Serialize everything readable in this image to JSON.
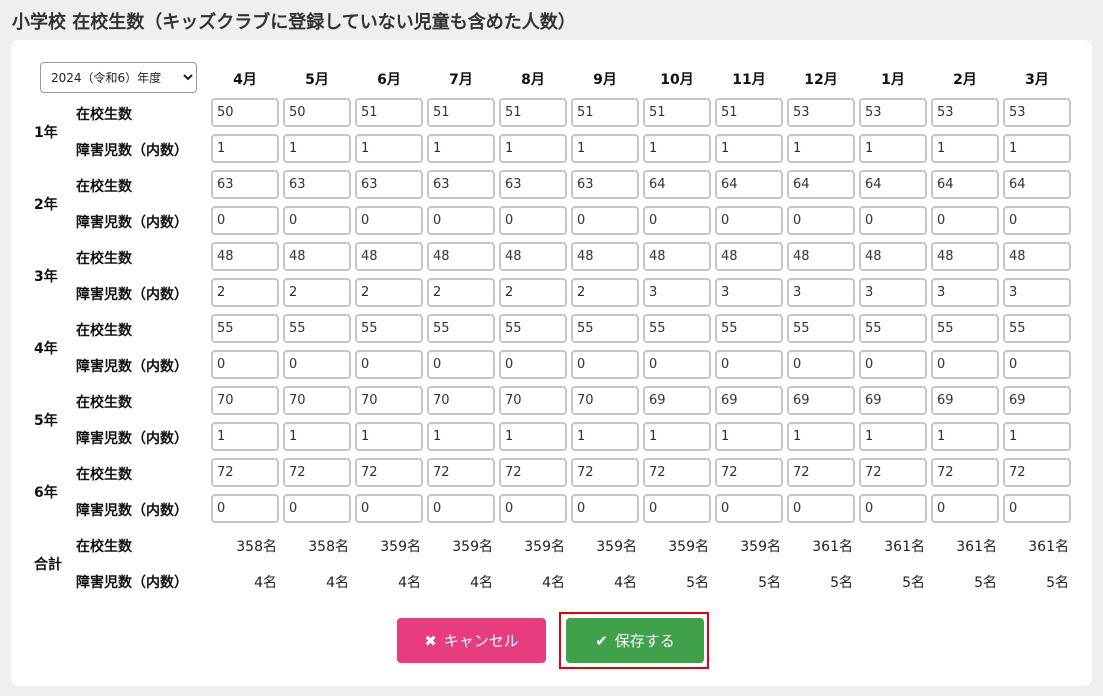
{
  "page_title": "小学校 在校生数（キッズクラブに登録していない児童も含めた人数）",
  "year_select": {
    "value": "2024（令和6）年度",
    "options": [
      "2024（令和6）年度"
    ]
  },
  "months": [
    "4月",
    "5月",
    "6月",
    "7月",
    "8月",
    "9月",
    "10月",
    "11月",
    "12月",
    "1月",
    "2月",
    "3月"
  ],
  "row_labels": {
    "enrolled": "在校生数",
    "disabled": "障害児数（内数）"
  },
  "grades": [
    {
      "label": "1年",
      "enrolled": [
        "50",
        "50",
        "51",
        "51",
        "51",
        "51",
        "51",
        "51",
        "53",
        "53",
        "53",
        "53"
      ],
      "disabled": [
        "1",
        "1",
        "1",
        "1",
        "1",
        "1",
        "1",
        "1",
        "1",
        "1",
        "1",
        "1"
      ]
    },
    {
      "label": "2年",
      "enrolled": [
        "63",
        "63",
        "63",
        "63",
        "63",
        "63",
        "64",
        "64",
        "64",
        "64",
        "64",
        "64"
      ],
      "disabled": [
        "0",
        "0",
        "0",
        "0",
        "0",
        "0",
        "0",
        "0",
        "0",
        "0",
        "0",
        "0"
      ]
    },
    {
      "label": "3年",
      "enrolled": [
        "48",
        "48",
        "48",
        "48",
        "48",
        "48",
        "48",
        "48",
        "48",
        "48",
        "48",
        "48"
      ],
      "disabled": [
        "2",
        "2",
        "2",
        "2",
        "2",
        "2",
        "3",
        "3",
        "3",
        "3",
        "3",
        "3"
      ]
    },
    {
      "label": "4年",
      "enrolled": [
        "55",
        "55",
        "55",
        "55",
        "55",
        "55",
        "55",
        "55",
        "55",
        "55",
        "55",
        "55"
      ],
      "disabled": [
        "0",
        "0",
        "0",
        "0",
        "0",
        "0",
        "0",
        "0",
        "0",
        "0",
        "0",
        "0"
      ]
    },
    {
      "label": "5年",
      "enrolled": [
        "70",
        "70",
        "70",
        "70",
        "70",
        "70",
        "69",
        "69",
        "69",
        "69",
        "69",
        "69"
      ],
      "disabled": [
        "1",
        "1",
        "1",
        "1",
        "1",
        "1",
        "1",
        "1",
        "1",
        "1",
        "1",
        "1"
      ]
    },
    {
      "label": "6年",
      "enrolled": [
        "72",
        "72",
        "72",
        "72",
        "72",
        "72",
        "72",
        "72",
        "72",
        "72",
        "72",
        "72"
      ],
      "disabled": [
        "0",
        "0",
        "0",
        "0",
        "0",
        "0",
        "0",
        "0",
        "0",
        "0",
        "0",
        "0"
      ]
    }
  ],
  "totals": {
    "label": "合計",
    "enrolled": [
      "358名",
      "358名",
      "359名",
      "359名",
      "359名",
      "359名",
      "359名",
      "359名",
      "361名",
      "361名",
      "361名",
      "361名"
    ],
    "disabled": [
      "4名",
      "4名",
      "4名",
      "4名",
      "4名",
      "4名",
      "5名",
      "5名",
      "5名",
      "5名",
      "5名",
      "5名"
    ]
  },
  "buttons": {
    "cancel_label": "キャンセル",
    "cancel_icon": "x-icon",
    "save_label": "保存する",
    "save_icon": "check-icon"
  },
  "colors": {
    "cancel": "#e73c7d",
    "save": "#3fa14a",
    "highlight_border": "#e0000f"
  }
}
